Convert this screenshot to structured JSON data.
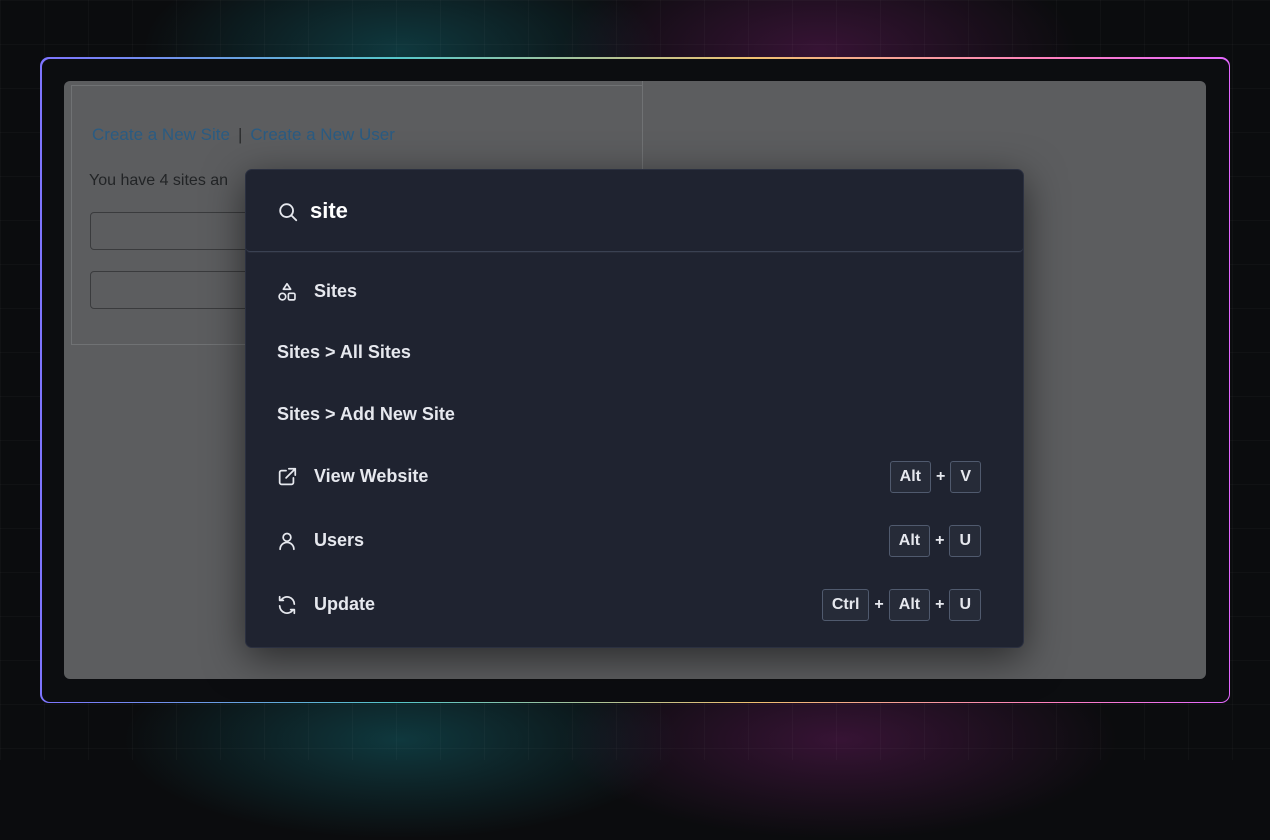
{
  "background_page": {
    "links": [
      "Create a New Site",
      "Create a New User"
    ],
    "separator": "|",
    "summary_text": "You have 4 sites an"
  },
  "palette": {
    "search": {
      "value": "site",
      "icon": "search-icon"
    },
    "items": [
      {
        "label": "Sites",
        "icon": "shapes-icon",
        "keys": []
      },
      {
        "label": "Sites > All Sites",
        "icon": null,
        "keys": []
      },
      {
        "label": "Sites > Add New Site",
        "icon": null,
        "keys": []
      },
      {
        "label": "View Website",
        "icon": "external-link-icon",
        "keys": [
          "Alt",
          "V"
        ]
      },
      {
        "label": "Users",
        "icon": "user-icon",
        "keys": [
          "Alt",
          "U"
        ]
      },
      {
        "label": "Update",
        "icon": "refresh-icon",
        "keys": [
          "Ctrl",
          "Alt",
          "U"
        ]
      }
    ],
    "key_separator": "+"
  },
  "colors": {
    "palette_bg": "#1f2330",
    "overlay_bg": "#5c5d5f",
    "link": "#2a5b82",
    "frame_gradient": [
      "#7e74ff",
      "#56c6c9",
      "#f0c070",
      "#ff7fc0",
      "#e468ff"
    ]
  }
}
